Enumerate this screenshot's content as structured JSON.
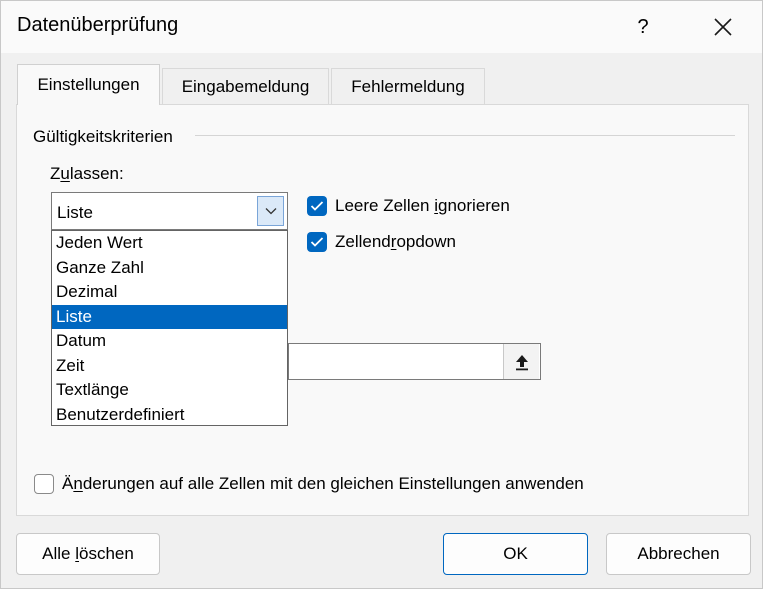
{
  "window": {
    "title": "Datenüberprüfung",
    "help_label": "?"
  },
  "tabs": [
    {
      "label": "Einstellungen",
      "active": true
    },
    {
      "label": "Eingabemeldung",
      "active": false
    },
    {
      "label": "Fehlermeldung",
      "active": false
    }
  ],
  "criteria": {
    "group_label": "Gültigkeitskriterien",
    "allow_label_pre": "Z",
    "allow_label_accel": "u",
    "allow_label_post": "lassen:",
    "allow_value": "Liste",
    "options": [
      "Jeden Wert",
      "Ganze Zahl",
      "Dezimal",
      "Liste",
      "Datum",
      "Zeit",
      "Textlänge",
      "Benutzerdefiniert"
    ],
    "selected_option": "Liste"
  },
  "checkboxes": {
    "ignore_blank": {
      "pre": "Leere Zellen ",
      "accel": "i",
      "post": "gnorieren",
      "checked": true
    },
    "in_cell_dropdown": {
      "pre": "Zellend",
      "accel": "r",
      "post": "opdown",
      "checked": true
    },
    "apply_all": {
      "pre": "Ä",
      "accel": "n",
      "post": "derungen auf alle Zellen mit den gleichen Einstellungen anwenden",
      "checked": false
    }
  },
  "buttons": {
    "clear_all_pre": "Alle ",
    "clear_all_accel": "l",
    "clear_all_post": "öschen",
    "ok": "OK",
    "cancel": "Abbrechen"
  },
  "colors": {
    "accent": "#0067c0",
    "background": "#f0f0f0",
    "panel": "#f9f9f9"
  }
}
